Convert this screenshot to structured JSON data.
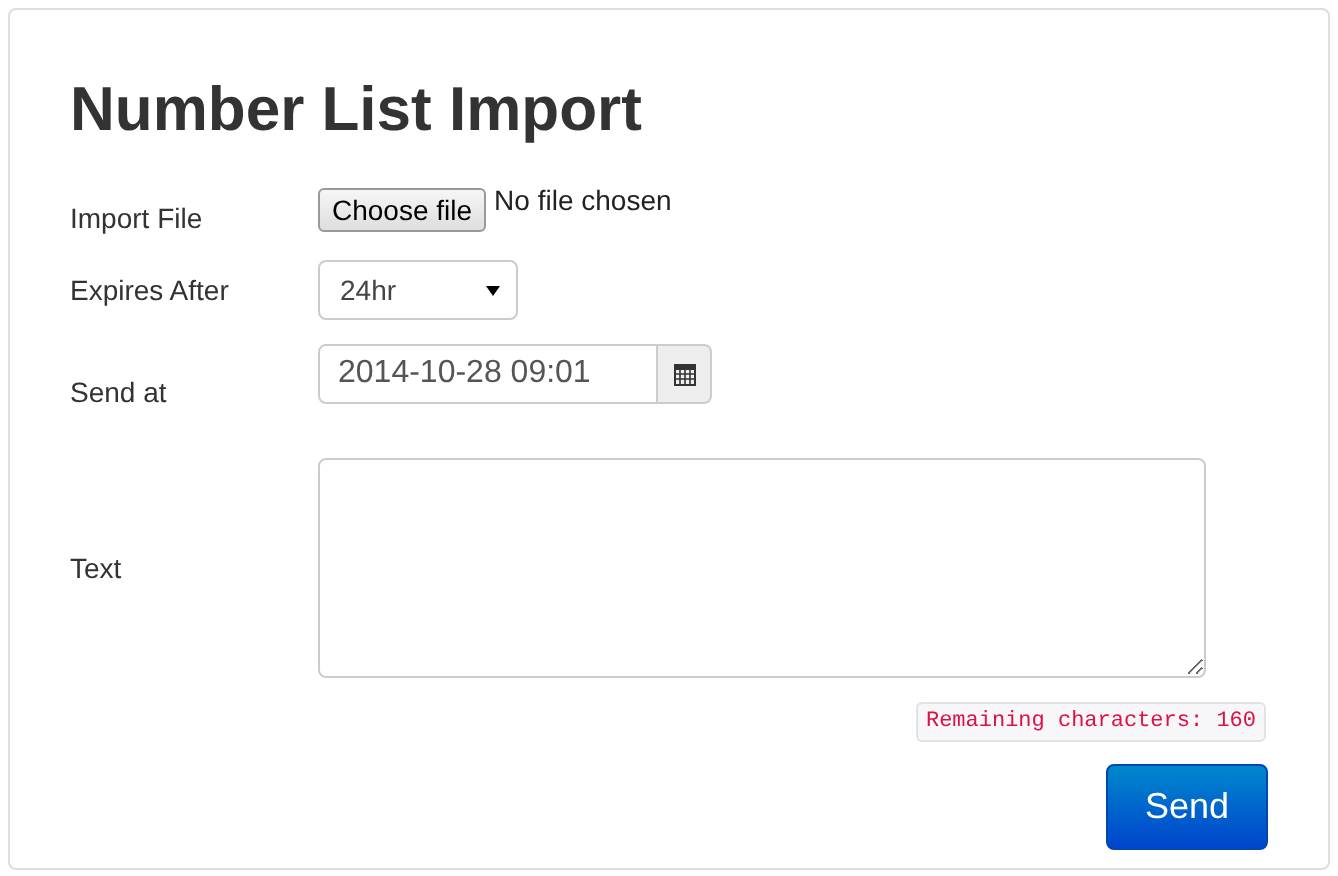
{
  "title": "Number List Import",
  "import_file": {
    "label": "Import File",
    "button": "Choose file",
    "status": "No file chosen"
  },
  "expires_after": {
    "label": "Expires After",
    "value": "24hr"
  },
  "send_at": {
    "label": "Send at",
    "value": "2014-10-28 09:01"
  },
  "text": {
    "label": "Text"
  },
  "remaining": "Remaining characters: 160",
  "submit": "Send"
}
